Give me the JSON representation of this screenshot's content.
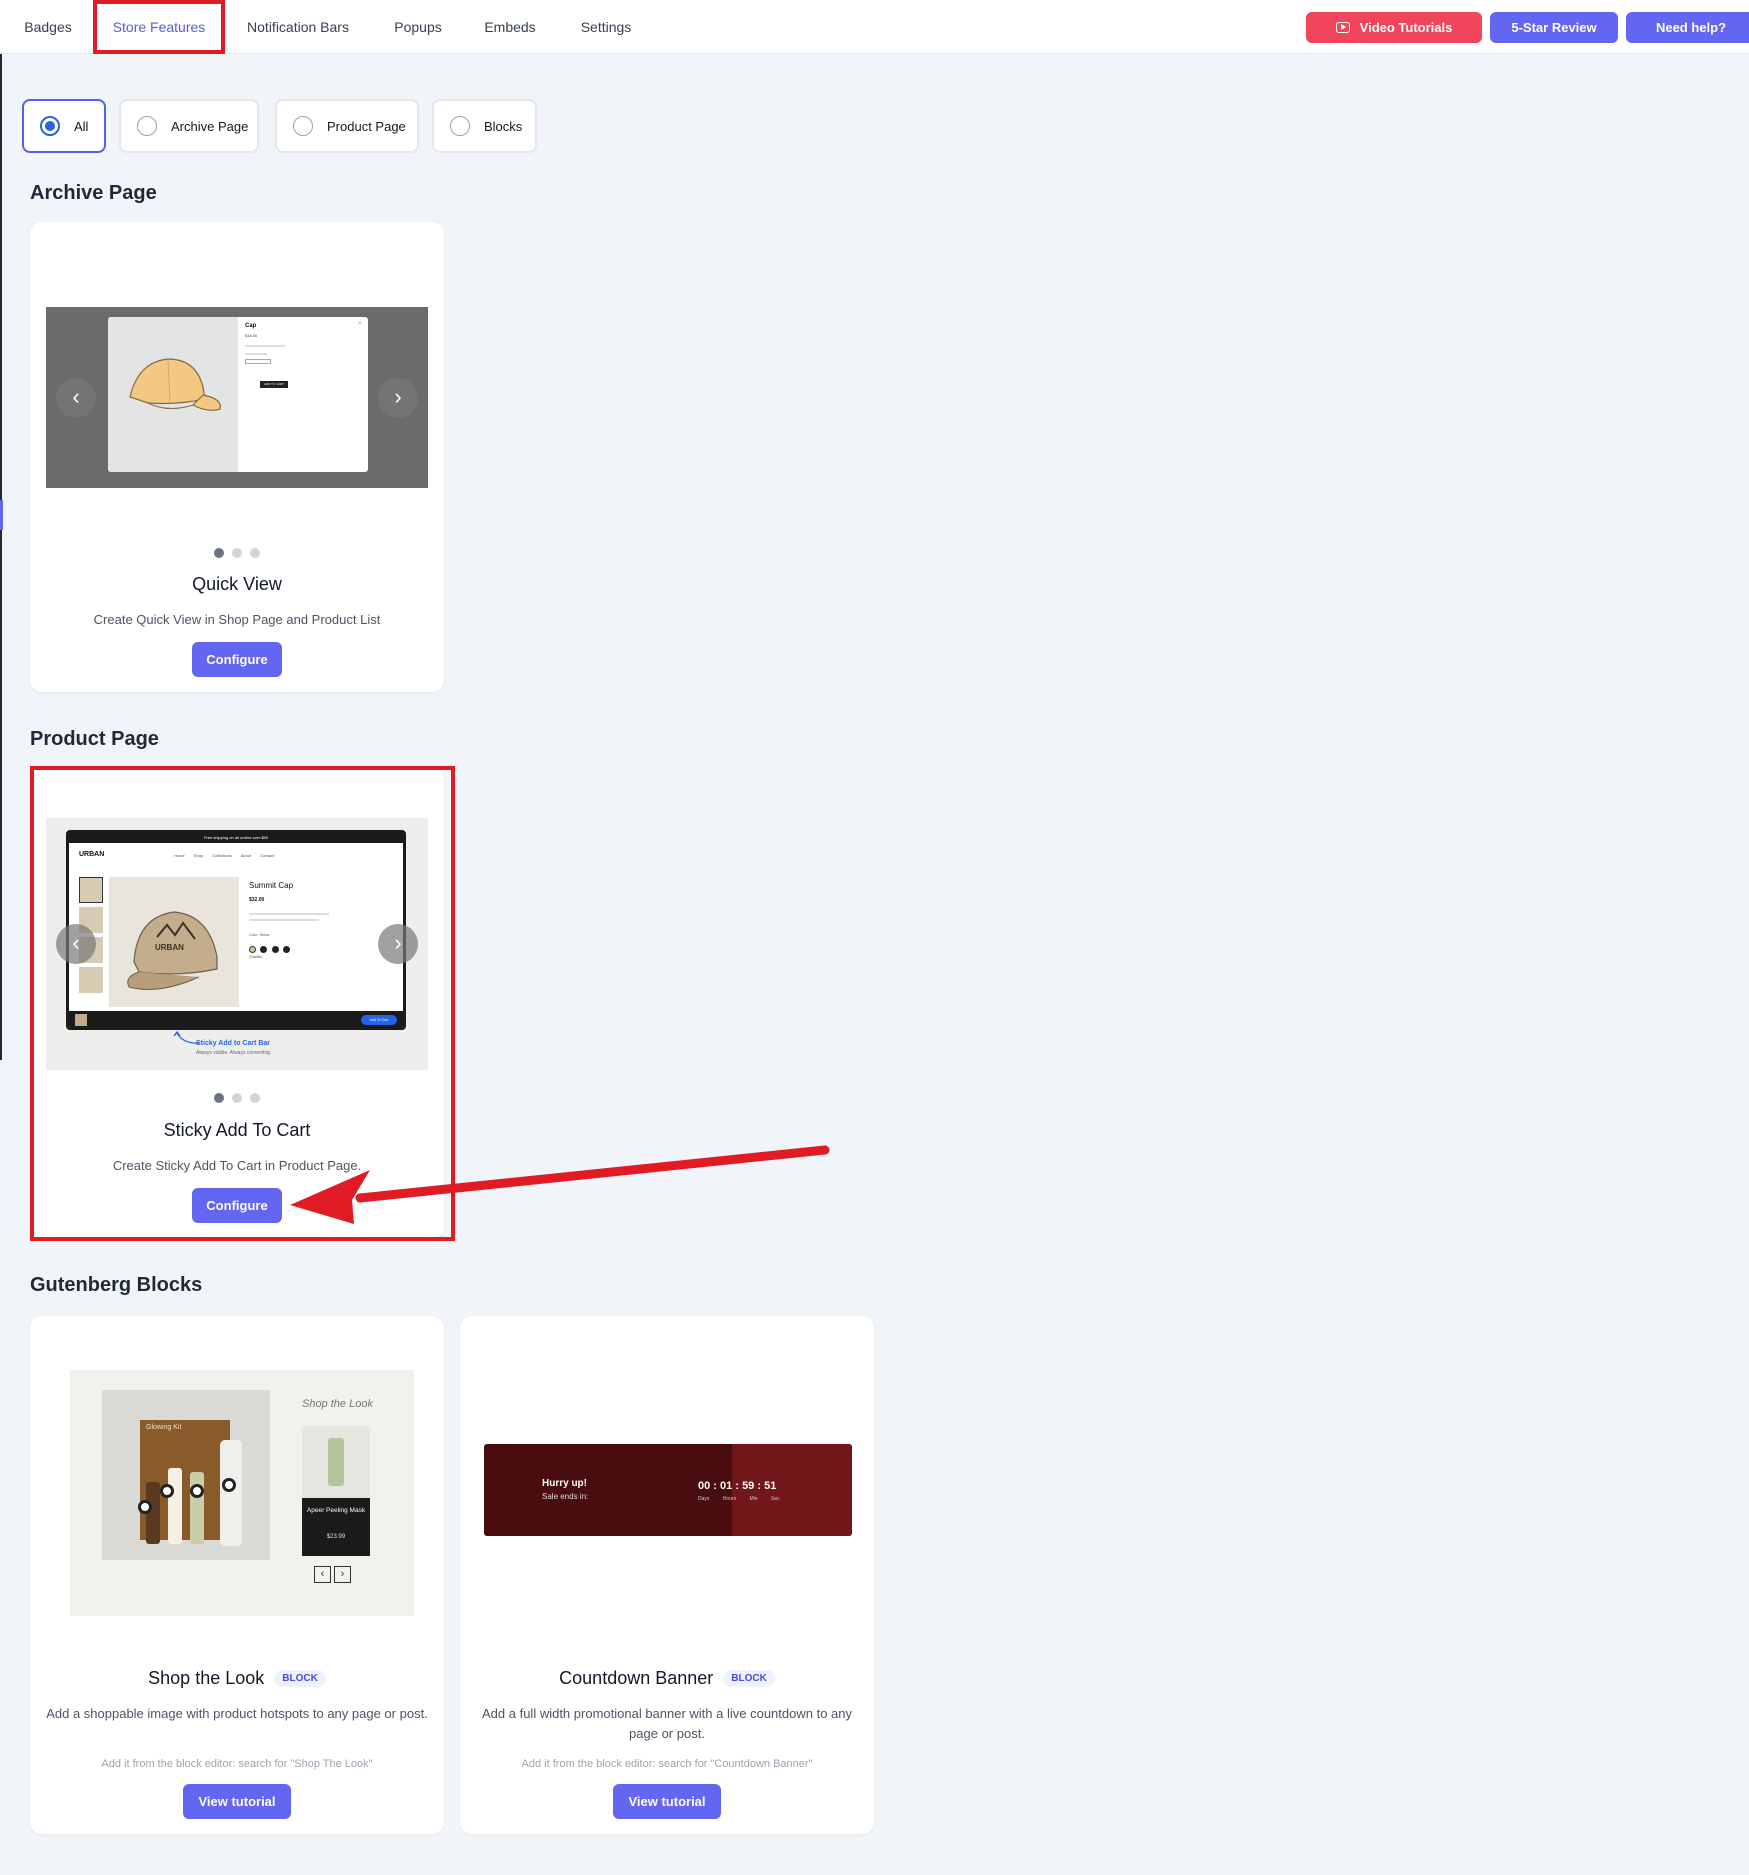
{
  "nav": {
    "tabs": [
      "Badges",
      "Store Features",
      "Notification Bars",
      "Popups",
      "Embeds",
      "Settings"
    ],
    "active_tab": "Store Features",
    "video_tutorials": "Video Tutorials",
    "five_star_review": "5-Star Review",
    "need_help": "Need help?"
  },
  "filters": [
    "All",
    "Archive Page",
    "Product Page",
    "Blocks"
  ],
  "selected_filter": "All",
  "sections": {
    "archive": "Archive Page",
    "product": "Product Page",
    "gutenberg": "Gutenberg Blocks"
  },
  "cards": {
    "quick_view": {
      "title": "Quick View",
      "desc": "Create Quick View in Shop Page and Product List",
      "button": "Configure",
      "preview": {
        "product": "Cap",
        "price": "$18.00",
        "cta": "ADD TO CART"
      }
    },
    "sticky_cart": {
      "title": "Sticky Add To Cart",
      "desc": "Create Sticky Add To Cart in Product Page.",
      "button": "Configure",
      "preview": {
        "promo": "Free shipping on all orders over $50",
        "brand": "URBAN",
        "menu": [
          "Home",
          "Shop",
          "Collections",
          "About",
          "Contact"
        ],
        "product": "Summit Cap",
        "price": "$32.00",
        "color_label": "Color: Yellow",
        "quantity_label": "Quantity",
        "cap_logo": "URBAN",
        "bar_cta": "Add To Cart",
        "caption": "Sticky Add to Cart Bar",
        "subcaption": "Always visible. Always converting."
      }
    },
    "shop_the_look": {
      "title": "Shop the Look",
      "badge": "BLOCK",
      "desc": "Add a shoppable image with product hotspots to any page or post.",
      "note": "Add it from the block editor: search for \"Shop The Look\"",
      "button": "View tutorial",
      "preview": {
        "heading": "Shop the Look",
        "kit": "Glowing Kit",
        "product": "Apeer Peeling Mask",
        "price": "$23.99"
      }
    },
    "countdown": {
      "title": "Countdown Banner",
      "badge": "BLOCK",
      "desc": "Add a full width promotional banner with a live countdown to any page or post.",
      "note": "Add it from the block editor: search for \"Countdown Banner\"",
      "button": "View tutorial",
      "preview": {
        "headline": "Hurry up!",
        "sub": "Sale ends in:",
        "timer": [
          "00",
          "01",
          "59",
          "51"
        ],
        "units": [
          "Days",
          "Hours",
          "Min",
          "Sec"
        ]
      }
    }
  }
}
